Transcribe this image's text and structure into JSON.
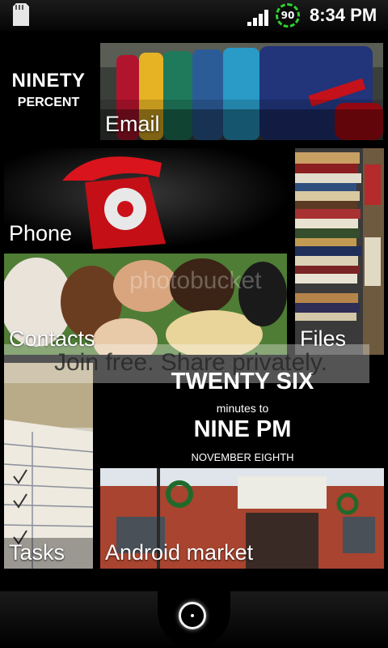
{
  "status_bar": {
    "battery_level": "90",
    "time": "8:34 PM",
    "icons": [
      "sd-card-icon",
      "signal-icon",
      "battery-icon"
    ]
  },
  "battery_widget": {
    "line1": "NINETY",
    "line2": "PERCENT"
  },
  "tiles": {
    "email": "Email",
    "phone": "Phone",
    "files": "Files",
    "contacts": "Contacts",
    "tasks": "Tasks",
    "android_market": "Android market"
  },
  "clock_widget": {
    "line1": "TWENTY SIX",
    "line2": "minutes to",
    "line3": "NINE PM",
    "line4": "NOVEMBER EIGHTH"
  },
  "watermark": {
    "brand": "photobucket",
    "tagline": "Join free. Share privately."
  },
  "dock": {
    "home_icon": "home-ring-icon"
  },
  "colors": {
    "background": "#000000",
    "battery_ring": "#2fd12f",
    "phone_red": "#d9141c"
  }
}
